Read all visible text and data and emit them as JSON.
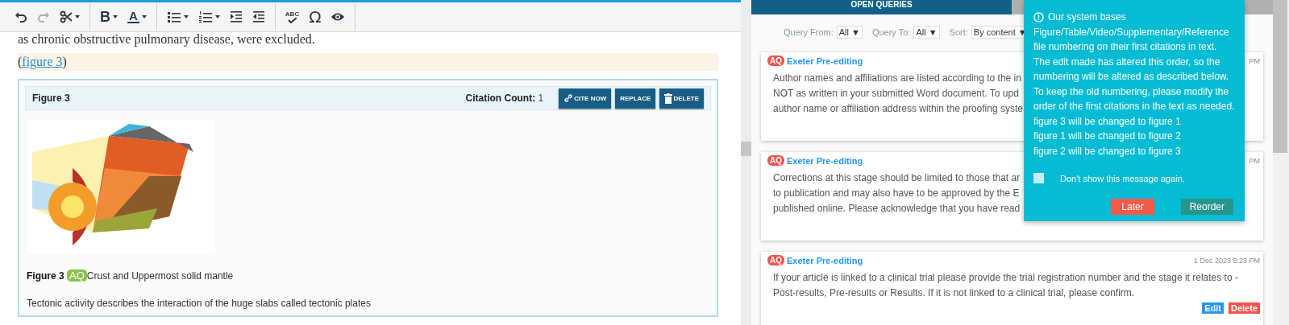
{
  "toolbar": {
    "groups": [
      [
        {
          "kind": "undo",
          "disabled": false
        },
        {
          "kind": "redo",
          "disabled": true
        },
        {
          "kind": "cut",
          "disabled": false
        }
      ],
      [
        {
          "kind": "bold",
          "glyph": "B",
          "disabled": false
        },
        {
          "kind": "color",
          "glyph": "A",
          "disabled": false
        }
      ],
      [
        {
          "kind": "bullets",
          "disabled": false
        },
        {
          "kind": "numbers",
          "disabled": false
        },
        {
          "kind": "indent",
          "disabled": false
        },
        {
          "kind": "outdent",
          "disabled": false
        }
      ],
      [
        {
          "kind": "spell",
          "glyph": "ABC",
          "disabled": false
        },
        {
          "kind": "symbol",
          "glyph": "Ω",
          "disabled": false
        },
        {
          "kind": "preview",
          "disabled": false
        }
      ]
    ]
  },
  "editor": {
    "paragraph": "as chronic obstructive pulmonary disease, were excluded.",
    "citation": {
      "before": "(",
      "link": "figure 3",
      "after": ")"
    },
    "figure": {
      "title": "Figure 3",
      "citation_label": "Citation Count:",
      "citation_count": "1",
      "buttons": [
        {
          "label": "CITE NOW",
          "kind": "cite"
        },
        {
          "label": "REPLACE",
          "kind": "replace"
        },
        {
          "label": "DELETE",
          "kind": "delete"
        }
      ],
      "caption_label": "Figure 3",
      "caption_badge": "AQ",
      "caption": "Crust and Uppermost solid mantle",
      "description": "Tectonic activity describes the interaction of the huge slabs called tectonic plates"
    }
  },
  "queries": {
    "title": "OPEN QUERIES",
    "filters": [
      {
        "label": "Query From:",
        "value": "All",
        "caret": "▼"
      },
      {
        "label": "Query To:",
        "value": "All",
        "caret": "▼"
      },
      {
        "label": "Sort:",
        "value": "By content",
        "caret": "▼"
      }
    ],
    "cards": [
      {
        "badge": "AQ",
        "author": "Exeter Pre-editing",
        "time": "PM",
        "lines": [
          "Author names and affiliations are listed according to the in",
          "NOT as written in your submitted Word document. To upd",
          "author name or affiliation address within the proofing syste"
        ]
      },
      {
        "badge": "AQ",
        "author": "Exeter Pre-editing",
        "time": "PM",
        "lines": [
          "Corrections at this stage should be limited to those that ar",
          "to publication and may also have to be approved by the E",
          "published online. Please acknowledge that you have read"
        ]
      },
      {
        "badge": "AQ",
        "author": "Exeter Pre-editing",
        "time": "1 Dec 2023 5:23 PM",
        "lines": [
          "If your article is linked to a clinical trial please provide the trial registration number and the stage it relates to -",
          "Post-results, Pre-results or Results. If it is not linked to a clinical trial, please confirm."
        ],
        "actions": [
          {
            "label": "Edit",
            "kind": "edit"
          },
          {
            "label": "Delete",
            "kind": "delete"
          }
        ]
      }
    ]
  },
  "popup": {
    "lines": [
      "Our system bases",
      "Figure/Table/Video/Supplementary/Reference",
      "file numbering on their first citations in text.",
      "The edit made has altered this order, so the",
      "numbering will be altered as described below.",
      "To keep the old numbering, please modify the",
      "order of the first citations in the text as needed.",
      "figure 3 will be changed to figure 1",
      "figure 1 will be changed to figure 2",
      "figure 2 will be changed to figure 3"
    ],
    "checkbox": {
      "label": "Don't show this message again.",
      "checked": false
    },
    "buttons": [
      {
        "label": "Later",
        "kind": "secondary"
      },
      {
        "label": "Reorder",
        "kind": "primary"
      }
    ]
  }
}
